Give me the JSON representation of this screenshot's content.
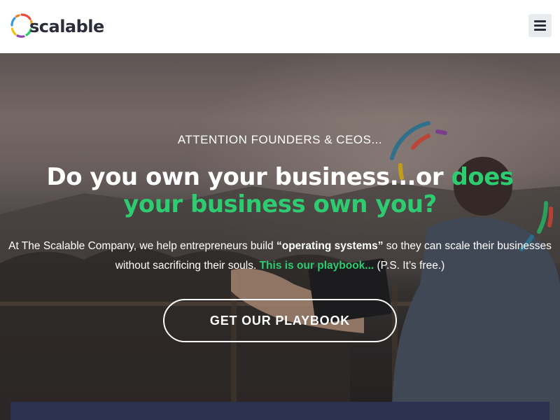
{
  "header": {
    "logo_text": "scalable",
    "logo_icon": "scalable-dashed-ring-logo",
    "menu_icon": "hamburger-menu-icon"
  },
  "hero": {
    "eyebrow": "ATTENTION FOUNDERS & CEOS...",
    "headline_part1": "Do you own your business...or ",
    "headline_green1": "does",
    "headline_green2": "your business own you?",
    "body_part1": "At The Scalable Company, we help entrepreneurs build ",
    "body_bold": "“operating systems”",
    "body_part2": " so they can scale their businesses without sacrificing their souls. ",
    "body_link": "This is our playbook...",
    "body_part3": " (P.S. It’s free.)",
    "cta_label": "GET OUR PLAYBOOK"
  },
  "colors": {
    "accent_green": "#2ecc71",
    "navy": "#2d3150",
    "text_dark": "#2b2d3a"
  }
}
